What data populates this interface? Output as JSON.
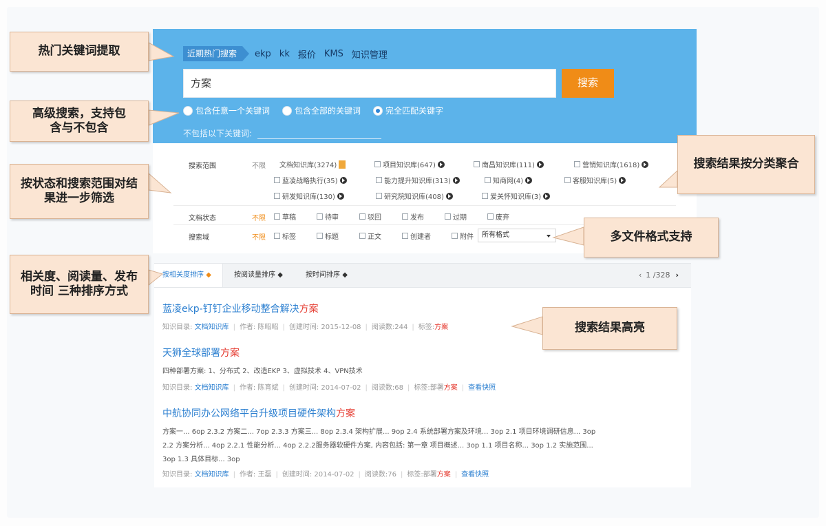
{
  "hot_search": {
    "label": "近期热门搜索",
    "keywords": [
      "ekp",
      "kk",
      "报价",
      "KMS",
      "知识管理"
    ]
  },
  "search": {
    "value": "方案",
    "button": "搜索"
  },
  "match_options": [
    {
      "label": "包含任意一个关键词",
      "checked": false
    },
    {
      "label": "包含全部的关键词",
      "checked": false
    },
    {
      "label": "完全匹配关键字",
      "checked": true
    }
  ],
  "exclude": {
    "label": "不包括以下关键词:"
  },
  "filters": {
    "scope_label": "搜索范围",
    "unlimited": "不限",
    "scope_items": [
      "文档知识库(3274)",
      "项目知识库(647)",
      "南昌知识库(111)",
      "营销知识库(1618)",
      "蓝凌战略执行(35)",
      "能力提升知识库(313)",
      "知商网(4)",
      "客服知识库(5)",
      "研发知识库(130)",
      "研究院知识库(408)",
      "爱关怀知识库(3)"
    ],
    "status_label": "文档状态",
    "status_items": [
      "草稿",
      "待审",
      "驳回",
      "发布",
      "过期",
      "废弃"
    ],
    "domain_label": "搜索域",
    "domain_items": [
      "标签",
      "标题",
      "正文",
      "创建者",
      "附件"
    ],
    "format_select": "所有格式"
  },
  "sort": {
    "tabs": [
      "按相关度排序",
      "按阅读量排序",
      "按时间排序"
    ],
    "pager": "1 /328"
  },
  "results": [
    {
      "title_pre": "蓝凌ekp-钉钉企业移动整合解决",
      "title_hl": "方案",
      "meta_path_label": "知识目录:",
      "meta_path": "文档知识库",
      "author": "作者: 陈昭昭",
      "created": "创建时间: 2015-12-08",
      "reads": "阅读数:244",
      "tags_label": "标签:",
      "tags_hl": "方案"
    },
    {
      "title_pre": "天狮全球部署",
      "title_hl": "方案",
      "snippet": "四种部署方案: 1、分布式 2、改造EKP 3、虚拟技术 4、VPN技术",
      "meta_path_label": "知识目录:",
      "meta_path": "文档知识库",
      "author": "作者: 陈育斌",
      "created": "创建时间: 2014-07-02",
      "reads": "阅读数:68",
      "tags_label": "标签:部署",
      "tags_hl": "方案",
      "snapshot": "查看快照"
    },
    {
      "title_pre": "中航协同办公网络平台升级项目硬件架构",
      "title_hl": "方案",
      "snippet1": "方案一... 6op 2.3.2 方案二... 7op 2.3.3 方案三... 8op 2.3.4 架构扩展... 9op 2.4 系统部署方案及环境... 3op 2.1 项目环境调研信息... 3op",
      "snippet2": "2.2 方案分析... 4op 2.2.1 性能分析... 4op 2.2.2服务器软硬件方案, 内容包括: 第一章 项目概述... 3op 1.1 项目名称... 3op 1.2 实施范围...",
      "snippet3": "3op 1.3 具体目标... 3op",
      "meta_path_label": "知识目录:",
      "meta_path": "文档知识库",
      "author": "作者: 王磊",
      "created": "创建时间: 2014-07-02",
      "reads": "阅读数:76",
      "tags_label": "标签:部署",
      "tags_hl": "方案",
      "snapshot": "查看快照"
    }
  ],
  "callouts": {
    "hot_keywords": "热门关键词提取",
    "advanced": "高级搜索，支持包含与不包含",
    "filter": "按状态和搜索范围对结果进一步筛选",
    "sorting": "相关度、阅读量、发布时间 三种排序方式",
    "grouping": "搜索结果按分类聚合",
    "formats": "多文件格式支持",
    "highlight": "搜索结果高亮"
  },
  "colors": {
    "panel_blue": "#5cb3ea",
    "button_orange": "#f08c17",
    "link_blue": "#2b7fd0",
    "highlight_red": "#e53a2f",
    "callout_bg": "#fbe5d3"
  }
}
